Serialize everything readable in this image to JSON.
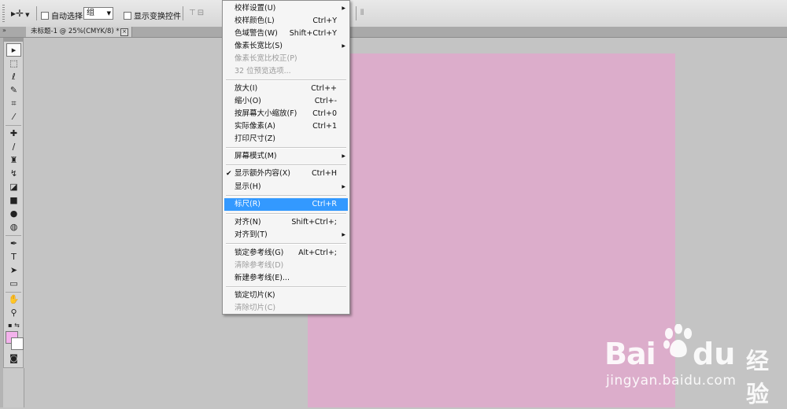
{
  "options_bar": {
    "tool_preset_icon": "move-tool-icon",
    "auto_select_label": "自动选择:",
    "auto_select_value": "组",
    "show_transform_label": "显示变换控件"
  },
  "document_tab": {
    "title": "未标题-1 @ 25%(CMYK/8) *",
    "close_glyph": "×"
  },
  "canvas": {
    "fill_color": "#dcadcb",
    "background_color": "#c4c4c4"
  },
  "swatches": {
    "foreground": "#f4b2ec",
    "background": "#ffffff"
  },
  "menu": {
    "items": [
      {
        "label": "校样设置(U)",
        "shortcut": "",
        "submenu": true
      },
      {
        "label": "校样颜色(L)",
        "shortcut": "Ctrl+Y"
      },
      {
        "label": "色域警告(W)",
        "shortcut": "Shift+Ctrl+Y"
      },
      {
        "label": "像素长宽比(S)",
        "shortcut": "",
        "submenu": true
      },
      {
        "label": "像素长宽比校正(P)",
        "shortcut": "",
        "disabled": true
      },
      {
        "label": "32 位预览选项...",
        "shortcut": "",
        "disabled": true
      },
      {
        "label": "放大(I)",
        "shortcut": "Ctrl++"
      },
      {
        "label": "缩小(O)",
        "shortcut": "Ctrl+-"
      },
      {
        "label": "按屏幕大小缩放(F)",
        "shortcut": "Ctrl+0"
      },
      {
        "label": "实际像素(A)",
        "shortcut": "Ctrl+1"
      },
      {
        "label": "打印尺寸(Z)",
        "shortcut": ""
      },
      {
        "label": "屏幕模式(M)",
        "shortcut": "",
        "submenu": true
      },
      {
        "label": "显示额外内容(X)",
        "shortcut": "Ctrl+H",
        "checked": true
      },
      {
        "label": "显示(H)",
        "shortcut": "",
        "submenu": true
      },
      {
        "label": "标尺(R)",
        "shortcut": "Ctrl+R",
        "highlighted": true
      },
      {
        "label": "对齐(N)",
        "shortcut": "Shift+Ctrl+;"
      },
      {
        "label": "对齐到(T)",
        "shortcut": "",
        "submenu": true
      },
      {
        "label": "锁定参考线(G)",
        "shortcut": "Alt+Ctrl+;"
      },
      {
        "label": "清除参考线(D)",
        "shortcut": "",
        "disabled": true
      },
      {
        "label": "新建参考线(E)...",
        "shortcut": ""
      },
      {
        "label": "锁定切片(K)",
        "shortcut": ""
      },
      {
        "label": "清除切片(C)",
        "shortcut": "",
        "disabled": true
      }
    ]
  },
  "watermark": {
    "brand_left": "Bai",
    "brand_right": "du",
    "brand_cn": "经验",
    "url": "jingyan.baidu.com"
  }
}
